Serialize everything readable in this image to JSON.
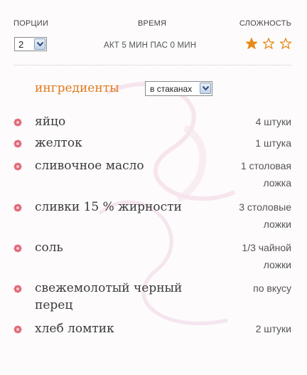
{
  "meta": {
    "portions_label": "ПОРЦИИ",
    "portions_value": "2",
    "time_label": "ВРЕМЯ",
    "time_value": "АКТ 5 МИН ПАС 0 МИН",
    "difficulty_label": "СЛОЖНОСТЬ",
    "difficulty_rating": 1,
    "difficulty_max": 3
  },
  "ingredients": {
    "title": "ингредиенты",
    "units_value": "в стаканах",
    "items": [
      {
        "name": "яйцо",
        "qty": [
          "4 штуки"
        ]
      },
      {
        "name": "желток",
        "qty": [
          "1 штука"
        ]
      },
      {
        "name": "сливочное масло",
        "qty": [
          "1 столовая",
          "ложка"
        ]
      },
      {
        "name": "сливки 15 % жирности",
        "qty": [
          "3 столовые",
          "ложки"
        ]
      },
      {
        "name": "соль",
        "qty": [
          "1/3 чайной",
          "ложки"
        ]
      },
      {
        "name": [
          "свежемолотый черный",
          "перец"
        ],
        "qty": [
          "по вкусу"
        ]
      },
      {
        "name": "хлеб ломтик",
        "qty": [
          "2 штуки"
        ]
      }
    ]
  },
  "colors": {
    "accent": "#e07b1f",
    "star": "#e88a1a",
    "bullet": "#e06a78"
  }
}
